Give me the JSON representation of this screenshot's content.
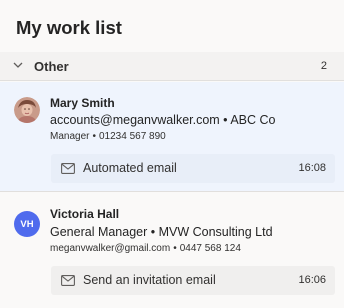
{
  "page": {
    "title": "My work list"
  },
  "group": {
    "label": "Other",
    "count": "2"
  },
  "items": [
    {
      "name": "Mary Smith",
      "contact_line": "accounts@meganvwalker.com • ABC Co",
      "role": "Manager",
      "phone": "01234 567 890",
      "activity": {
        "label": "Automated email",
        "time": "16:08",
        "icon": "mail-icon"
      }
    },
    {
      "initials": "VH",
      "name": "Victoria Hall",
      "contact_line": "General Manager • MVW Consulting Ltd",
      "email": "meganvwalker@gmail.com",
      "phone": "0447 568 124",
      "activity": {
        "label": "Send an invitation email",
        "time": "16:06",
        "icon": "mail-icon"
      }
    }
  ],
  "colors": {
    "selected_background": "#eff4fd",
    "avatar_initials_background": "#4f6bed"
  }
}
